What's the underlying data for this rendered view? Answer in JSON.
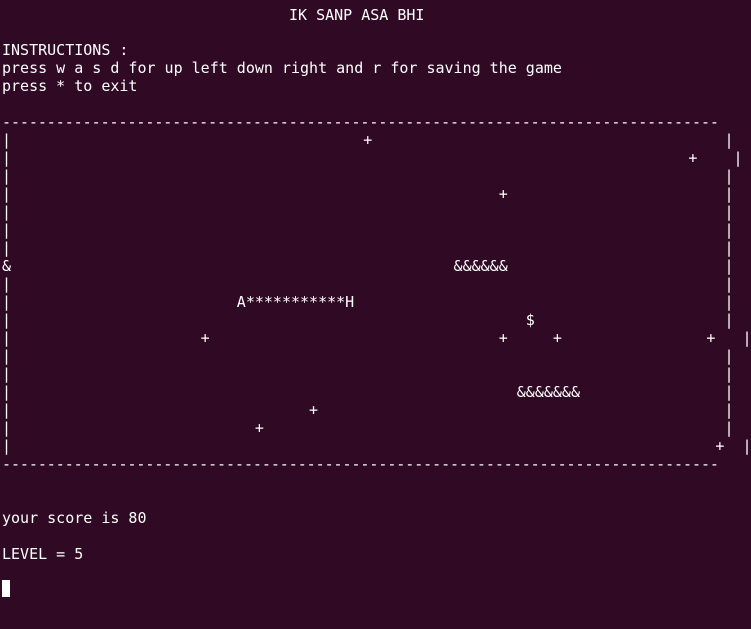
{
  "title": "IK SANP ASA BHI",
  "instructions": {
    "heading": "INSTRUCTIONS :",
    "line1": "press w a s d for up left down right and r for saving the game",
    "line2": "press * to exit"
  },
  "board": {
    "top_border": "--------------------------------------------------------------------------------",
    "bottom_border": "--------------------------------------------------------------------------------",
    "rows": [
      "|                                       +                                       |",
      "|                                                                           +    |",
      "|                                                                               |",
      "|                                                      +                        |",
      "|                                                                               |",
      "|                                                                               |",
      "|                                                                               |",
      "&                                                 &&&&&&                        |",
      "|                                                                               |",
      "|                         A***********H                                         |",
      "|                                                         $                     |",
      "|                     +                                +     +                +   |",
      "|                                                                               |",
      "|                                                                               |",
      "|                                                        &&&&&&&                |",
      "|                                 +                                             |",
      "|                           +                                                   |",
      "|                                                                              +  |"
    ]
  },
  "status": {
    "score_text": "your score is 80",
    "level_text": "LEVEL = 5"
  }
}
